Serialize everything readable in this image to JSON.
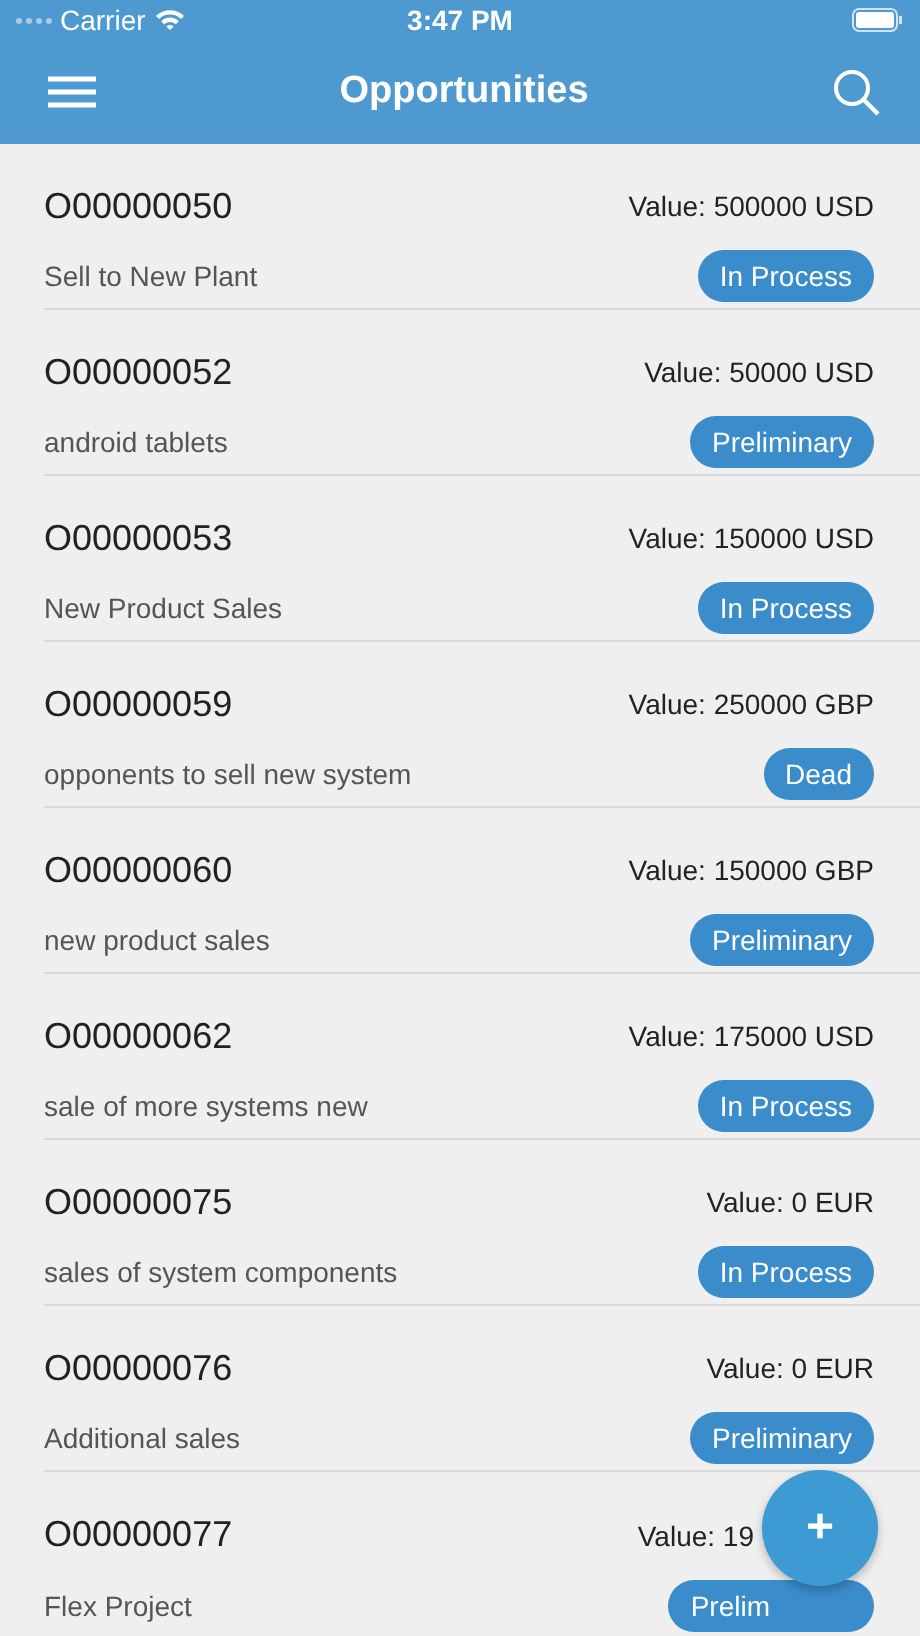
{
  "status_bar": {
    "carrier": "Carrier",
    "time": "3:47 PM"
  },
  "nav": {
    "title": "Opportunities"
  },
  "opportunities": [
    {
      "id": "O00000050",
      "description": "Sell to New Plant",
      "value": "Value: 500000 USD",
      "status": "In Process"
    },
    {
      "id": "O00000052",
      "description": "android tablets",
      "value": "Value: 50000 USD",
      "status": "Preliminary"
    },
    {
      "id": "O00000053",
      "description": "New Product Sales",
      "value": "Value: 150000 USD",
      "status": "In Process"
    },
    {
      "id": "O00000059",
      "description": "opponents to sell new system",
      "value": "Value: 250000 GBP",
      "status": "Dead"
    },
    {
      "id": "O00000060",
      "description": "new product sales",
      "value": "Value: 150000 GBP",
      "status": "Preliminary"
    },
    {
      "id": "O00000062",
      "description": "sale of more systems new",
      "value": "Value: 175000 USD",
      "status": "In Process"
    },
    {
      "id": "O00000075",
      "description": "sales of system components",
      "value": "Value: 0 EUR",
      "status": "In Process"
    },
    {
      "id": "O00000076",
      "description": "Additional sales",
      "value": "Value: 0 EUR",
      "status": "Preliminary"
    },
    {
      "id": "O00000077",
      "description": "Flex Project",
      "value": "Value: 19",
      "status": "Prelim"
    }
  ],
  "add_button": {
    "label": "+"
  }
}
